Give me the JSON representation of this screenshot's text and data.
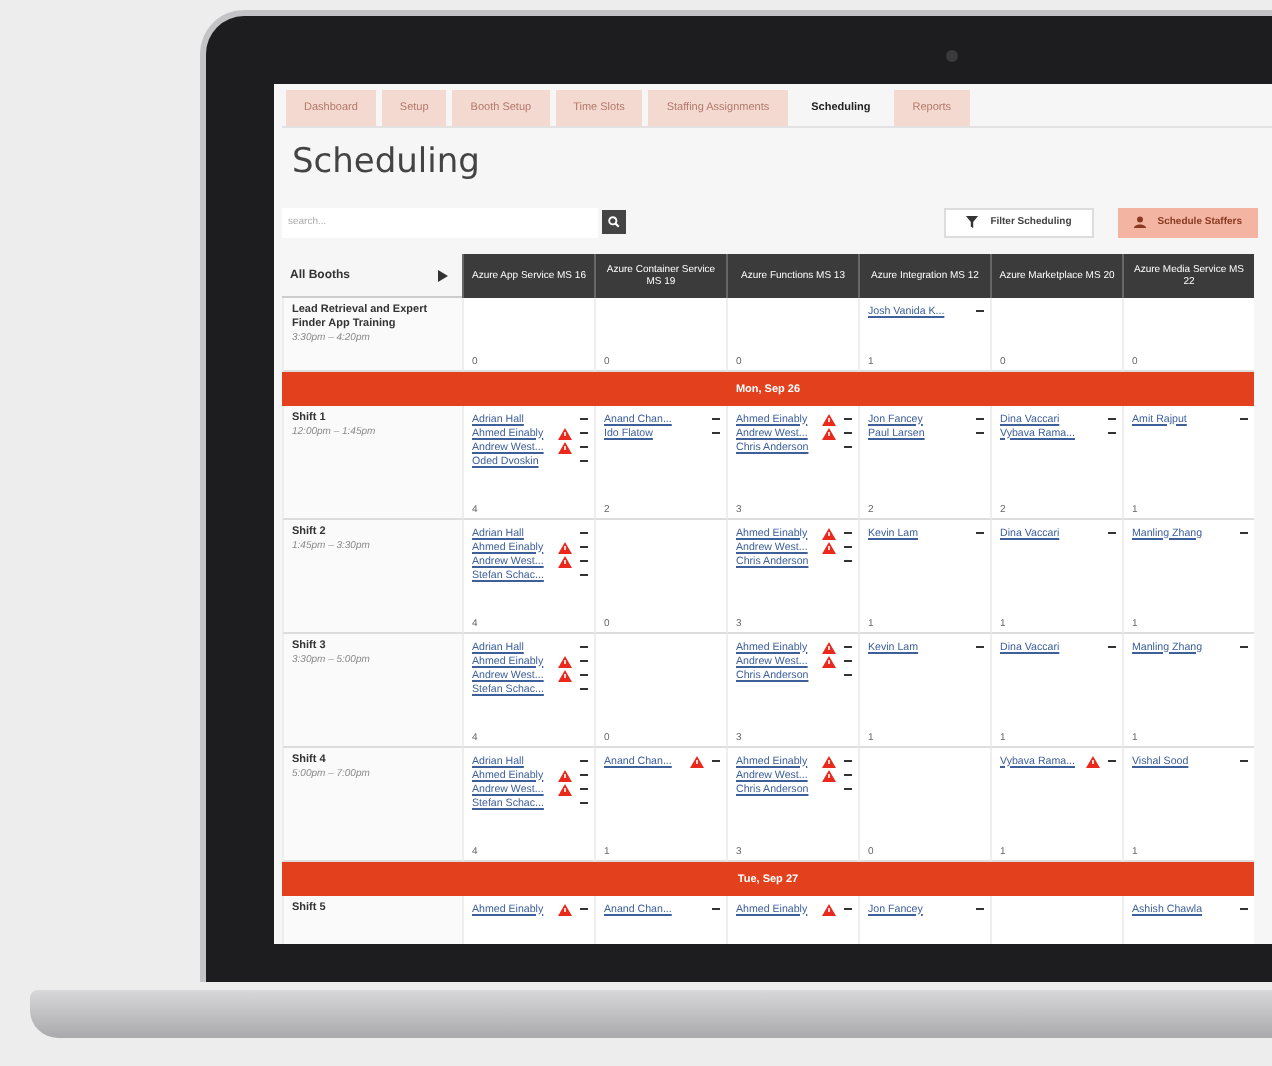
{
  "tabs": [
    {
      "label": "Dashboard",
      "selected": false
    },
    {
      "label": "Setup",
      "selected": false
    },
    {
      "label": "Booth Setup",
      "selected": false
    },
    {
      "label": "Time Slots",
      "selected": false
    },
    {
      "label": "Staffing Assignments",
      "selected": false
    },
    {
      "label": "Scheduling",
      "selected": true
    },
    {
      "label": "Reports",
      "selected": false
    }
  ],
  "title": "Scheduling",
  "search": {
    "placeholder": "search..."
  },
  "buttons": {
    "filter": "Filter Scheduling",
    "schedule": "Schedule Staffers"
  },
  "table": {
    "booth_filter": "All Booths",
    "columns": [
      "Azure App Service MS 16",
      "Azure Container Service MS 19",
      "Azure Functions MS 13",
      "Azure Integration MS 12",
      "Azure Marketplace MS 20",
      "Azure Media Service MS 22"
    ],
    "rows": [
      {
        "kind": "session",
        "name": "Lead Retrieval and Expert Finder App Training",
        "time": "3:30pm – 4:20pm",
        "cells": [
          {
            "count": "0"
          },
          {
            "count": "0"
          },
          {
            "count": "0"
          },
          {
            "staff": [
              {
                "name": "Josh Vanida K...",
                "warning": false
              }
            ],
            "count": "1"
          },
          {
            "count": "0"
          },
          {
            "count": "0"
          }
        ]
      },
      {
        "kind": "day",
        "label": "Mon, Sep 26"
      },
      {
        "kind": "session",
        "name": "Shift 1",
        "time": "12:00pm – 1:45pm",
        "cells": [
          {
            "staff": [
              {
                "name": "Adrian Hall",
                "warning": false
              },
              {
                "name": "Ahmed Einably",
                "warning": true
              },
              {
                "name": "Andrew West...",
                "warning": true
              },
              {
                "name": "Oded Dvoskin",
                "warning": false
              }
            ],
            "count": "4"
          },
          {
            "staff": [
              {
                "name": "Anand Chan...",
                "warning": false
              },
              {
                "name": "Ido Flatow",
                "warning": false
              }
            ],
            "count": "2"
          },
          {
            "staff": [
              {
                "name": "Ahmed Einably",
                "warning": true
              },
              {
                "name": "Andrew West...",
                "warning": true
              },
              {
                "name": "Chris Anderson",
                "warning": false
              }
            ],
            "count": "3"
          },
          {
            "staff": [
              {
                "name": "Jon Fancey",
                "warning": false
              },
              {
                "name": "Paul Larsen",
                "warning": false
              }
            ],
            "count": "2"
          },
          {
            "staff": [
              {
                "name": "Dina Vaccari",
                "warning": false
              },
              {
                "name": "Vybava Rama...",
                "warning": false
              }
            ],
            "count": "2"
          },
          {
            "staff": [
              {
                "name": "Amit Rajput",
                "warning": false
              }
            ],
            "count": "1"
          }
        ]
      },
      {
        "kind": "session",
        "name": "Shift 2",
        "time": "1:45pm – 3:30pm",
        "cells": [
          {
            "staff": [
              {
                "name": "Adrian Hall",
                "warning": false
              },
              {
                "name": "Ahmed Einably",
                "warning": true
              },
              {
                "name": "Andrew West...",
                "warning": true
              },
              {
                "name": "Stefan Schac...",
                "warning": false
              }
            ],
            "count": "4"
          },
          {
            "count": "0"
          },
          {
            "staff": [
              {
                "name": "Ahmed Einably",
                "warning": true
              },
              {
                "name": "Andrew West...",
                "warning": true
              },
              {
                "name": "Chris Anderson",
                "warning": false
              }
            ],
            "count": "3"
          },
          {
            "staff": [
              {
                "name": "Kevin Lam",
                "warning": false
              }
            ],
            "count": "1"
          },
          {
            "staff": [
              {
                "name": "Dina Vaccari",
                "warning": false
              }
            ],
            "count": "1"
          },
          {
            "staff": [
              {
                "name": "Manling Zhang",
                "warning": false
              }
            ],
            "count": "1"
          }
        ]
      },
      {
        "kind": "session",
        "name": "Shift 3",
        "time": "3:30pm – 5:00pm",
        "cells": [
          {
            "staff": [
              {
                "name": "Adrian Hall",
                "warning": false
              },
              {
                "name": "Ahmed Einably",
                "warning": true
              },
              {
                "name": "Andrew West...",
                "warning": true
              },
              {
                "name": "Stefan Schac...",
                "warning": false
              }
            ],
            "count": "4"
          },
          {
            "count": "0"
          },
          {
            "staff": [
              {
                "name": "Ahmed Einably",
                "warning": true
              },
              {
                "name": "Andrew West...",
                "warning": true
              },
              {
                "name": "Chris Anderson",
                "warning": false
              }
            ],
            "count": "3"
          },
          {
            "staff": [
              {
                "name": "Kevin Lam",
                "warning": false
              }
            ],
            "count": "1"
          },
          {
            "staff": [
              {
                "name": "Dina Vaccari",
                "warning": false
              }
            ],
            "count": "1"
          },
          {
            "staff": [
              {
                "name": "Manling Zhang",
                "warning": false
              }
            ],
            "count": "1"
          }
        ]
      },
      {
        "kind": "session",
        "name": "Shift 4",
        "time": "5:00pm – 7:00pm",
        "cells": [
          {
            "staff": [
              {
                "name": "Adrian Hall",
                "warning": false
              },
              {
                "name": "Ahmed Einably",
                "warning": true
              },
              {
                "name": "Andrew West...",
                "warning": true
              },
              {
                "name": "Stefan Schac...",
                "warning": false
              }
            ],
            "count": "4"
          },
          {
            "staff": [
              {
                "name": "Anand Chan...",
                "warning": true
              }
            ],
            "count": "1"
          },
          {
            "staff": [
              {
                "name": "Ahmed Einably",
                "warning": true
              },
              {
                "name": "Andrew West...",
                "warning": true
              },
              {
                "name": "Chris Anderson",
                "warning": false
              }
            ],
            "count": "3"
          },
          {
            "count": "0"
          },
          {
            "staff": [
              {
                "name": "Vybava Rama...",
                "warning": true
              }
            ],
            "count": "1"
          },
          {
            "staff": [
              {
                "name": "Vishal Sood",
                "warning": false
              }
            ],
            "count": "1"
          }
        ]
      },
      {
        "kind": "day",
        "label": "Tue, Sep 27"
      },
      {
        "kind": "session",
        "name": "Shift 5",
        "cells": [
          {
            "staff": [
              {
                "name": "Ahmed Einably",
                "warning": true
              }
            ]
          },
          {
            "staff": [
              {
                "name": "Anand Chan...",
                "warning": false
              }
            ]
          },
          {
            "staff": [
              {
                "name": "Ahmed Einably",
                "warning": true
              }
            ]
          },
          {
            "staff": [
              {
                "name": "Jon Fancey",
                "warning": false
              }
            ]
          },
          {},
          {
            "staff": [
              {
                "name": "Ashish Chawla",
                "warning": false
              }
            ]
          }
        ]
      }
    ]
  }
}
